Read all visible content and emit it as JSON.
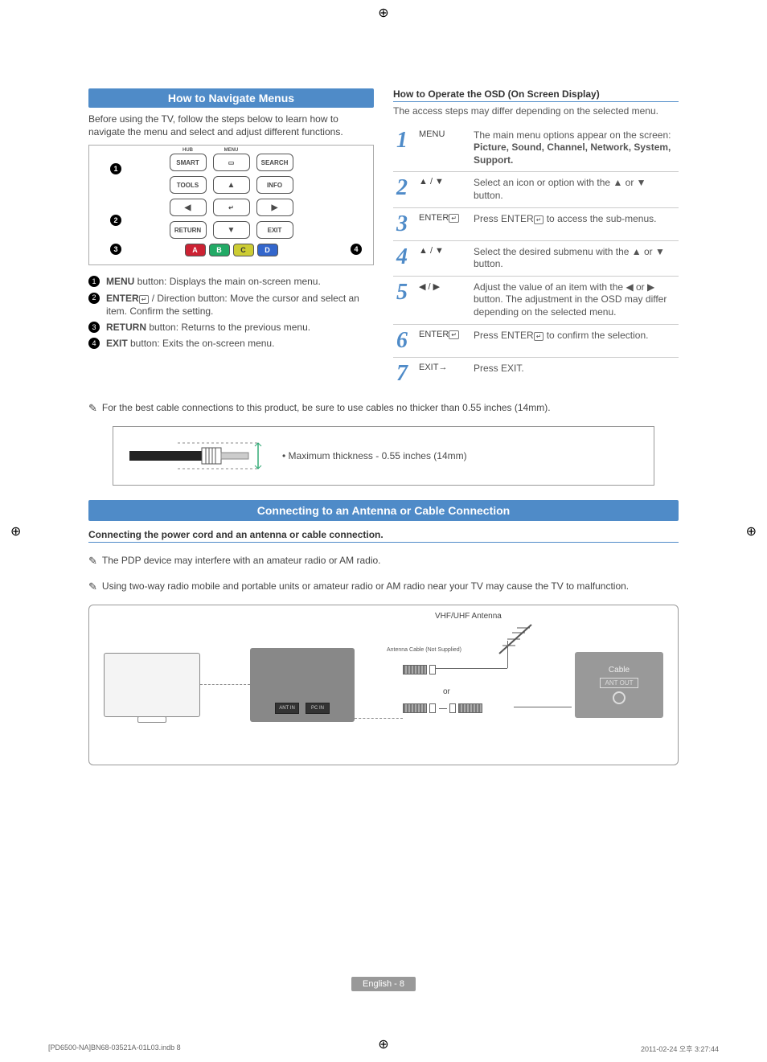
{
  "section1": {
    "title": "How to Navigate Menus",
    "intro": "Before using the TV, follow the steps below to learn how to navigate the menu and select and adjust different functions.",
    "remote": {
      "smart_tiny": "HUB",
      "menu_tiny": "MENU",
      "smart": "SMART",
      "menu_btn": "▭",
      "search": "SEARCH",
      "tools": "TOOLS",
      "up": "▲",
      "info": "INFO",
      "left": "◀",
      "enter": "↵",
      "right": "▶",
      "return": "RETURN",
      "down": "▼",
      "exit": "EXIT",
      "A": "A",
      "B": "B",
      "C": "C",
      "D": "D"
    },
    "legend": [
      {
        "n": "1",
        "label": "MENU",
        "text": " button: Displays the main on-screen menu."
      },
      {
        "n": "2",
        "label": "ENTER",
        "icon": "↵",
        "text": " / Direction button: Move the cursor and select an item. Confirm the setting."
      },
      {
        "n": "3",
        "label": "RETURN",
        "text": " button: Returns to the previous menu."
      },
      {
        "n": "4",
        "label": "EXIT",
        "text": " button: Exits the on-screen menu."
      }
    ]
  },
  "osd": {
    "title": "How to Operate the OSD (On Screen Display)",
    "desc": "The access steps may differ depending on the selected menu.",
    "rows": [
      {
        "n": "1",
        "btn": "MENU",
        "desc": "The main menu options appear on the screen:",
        "bold": "Picture, Sound, Channel, Network, System, Support."
      },
      {
        "n": "2",
        "btn": "▲ / ▼",
        "desc": "Select an icon or option with the ▲ or ▼ button."
      },
      {
        "n": "3",
        "btn": "ENTER",
        "icon": "↵",
        "desc_pre": "Press ENTER",
        "desc_post": " to access the sub-menus."
      },
      {
        "n": "4",
        "btn": "▲ / ▼",
        "desc": "Select the desired submenu with the ▲ or ▼ button."
      },
      {
        "n": "5",
        "btn": "◀ / ▶",
        "desc": "Adjust the value of an item with the ◀ or ▶ button. The adjustment in the OSD may differ depending on the selected menu."
      },
      {
        "n": "6",
        "btn": "ENTER",
        "icon": "↵",
        "desc_pre": "Press ENTER",
        "desc_post": " to confirm the selection."
      },
      {
        "n": "7",
        "btn": "EXIT→",
        "desc": "Press EXIT."
      }
    ]
  },
  "cable_note": "For the best cable connections to this product, be sure to use cables no thicker than 0.55 inches (14mm).",
  "cable_box_text": "Maximum thickness - 0.55 inches (14mm)",
  "section2": {
    "title": "Connecting to an Antenna or Cable Connection",
    "sub": "Connecting the power cord and an antenna or cable connection.",
    "note1": "The PDP device may interfere with an amateur radio or AM radio.",
    "note2": "Using two-way radio mobile and portable units or amateur radio or AM radio near your TV may cause the TV to malfunction.",
    "diagram": {
      "vhf": "VHF/UHF Antenna",
      "ant_cable": "Antenna Cable (Not Supplied)",
      "or": "or",
      "cable": "Cable",
      "ant_out": "ANT OUT",
      "ant_in": "ANT IN",
      "pc_in": "PC IN"
    }
  },
  "footer": {
    "page": "English - 8"
  },
  "meta": {
    "left": "[PD6500-NA]BN68-03521A-01L03.indb   8",
    "right": "2011-02-24   오후 3:27:44"
  }
}
